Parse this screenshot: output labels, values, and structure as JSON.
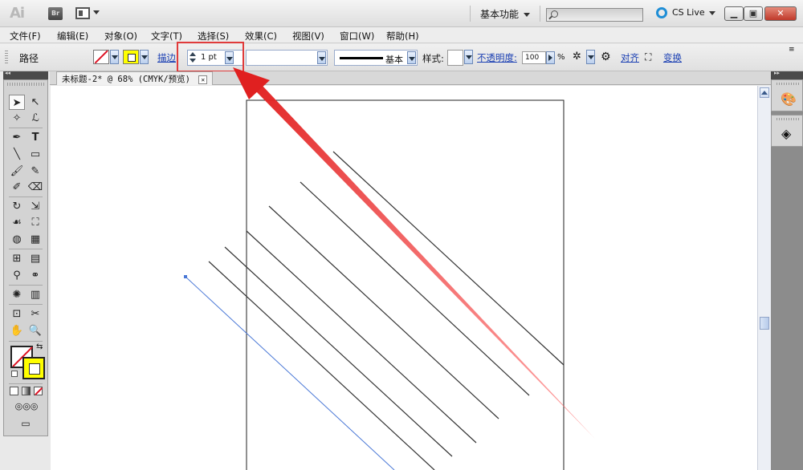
{
  "app": {
    "logo": "Ai",
    "bridge_label": "Br",
    "workspace": "基本功能",
    "search_placeholder": "",
    "cslive": "CS Live"
  },
  "menu": [
    "文件(F)",
    "编辑(E)",
    "对象(O)",
    "文字(T)",
    "选择(S)",
    "效果(C)",
    "视图(V)",
    "窗口(W)",
    "帮助(H)"
  ],
  "control": {
    "object_type": "路径",
    "stroke_link": "描边",
    "stroke_weight": "1 pt",
    "brush_label": "基本",
    "style_label": "样式:",
    "opacity_link": "不透明度:",
    "opacity_value": "100",
    "percent": "%",
    "align_link": "对齐",
    "transform_link": "变换"
  },
  "document": {
    "tab_title": "未标题-2* @ 68% (CMYK/预览)",
    "close_glyph": "✕"
  },
  "colors": {
    "annotation_red": "#e03b3b",
    "selection_blue": "#4a78d6",
    "stroke_yellow": "#ffff00"
  },
  "tools": [
    "selection-tool",
    "direct-selection-tool",
    "magic-wand-tool",
    "lasso-tool",
    "pen-tool",
    "type-tool",
    "line-tool",
    "rectangle-tool",
    "paintbrush-tool",
    "pencil-tool",
    "blob-brush-tool",
    "eraser-tool",
    "rotate-tool",
    "scale-tool",
    "warp-tool",
    "free-transform-tool",
    "shape-builder-tool",
    "perspective-grid-tool",
    "mesh-tool",
    "gradient-tool",
    "eyedropper-tool",
    "blend-tool",
    "symbol-sprayer-tool",
    "column-graph-tool",
    "artboard-tool",
    "slice-tool",
    "hand-tool",
    "zoom-tool"
  ]
}
